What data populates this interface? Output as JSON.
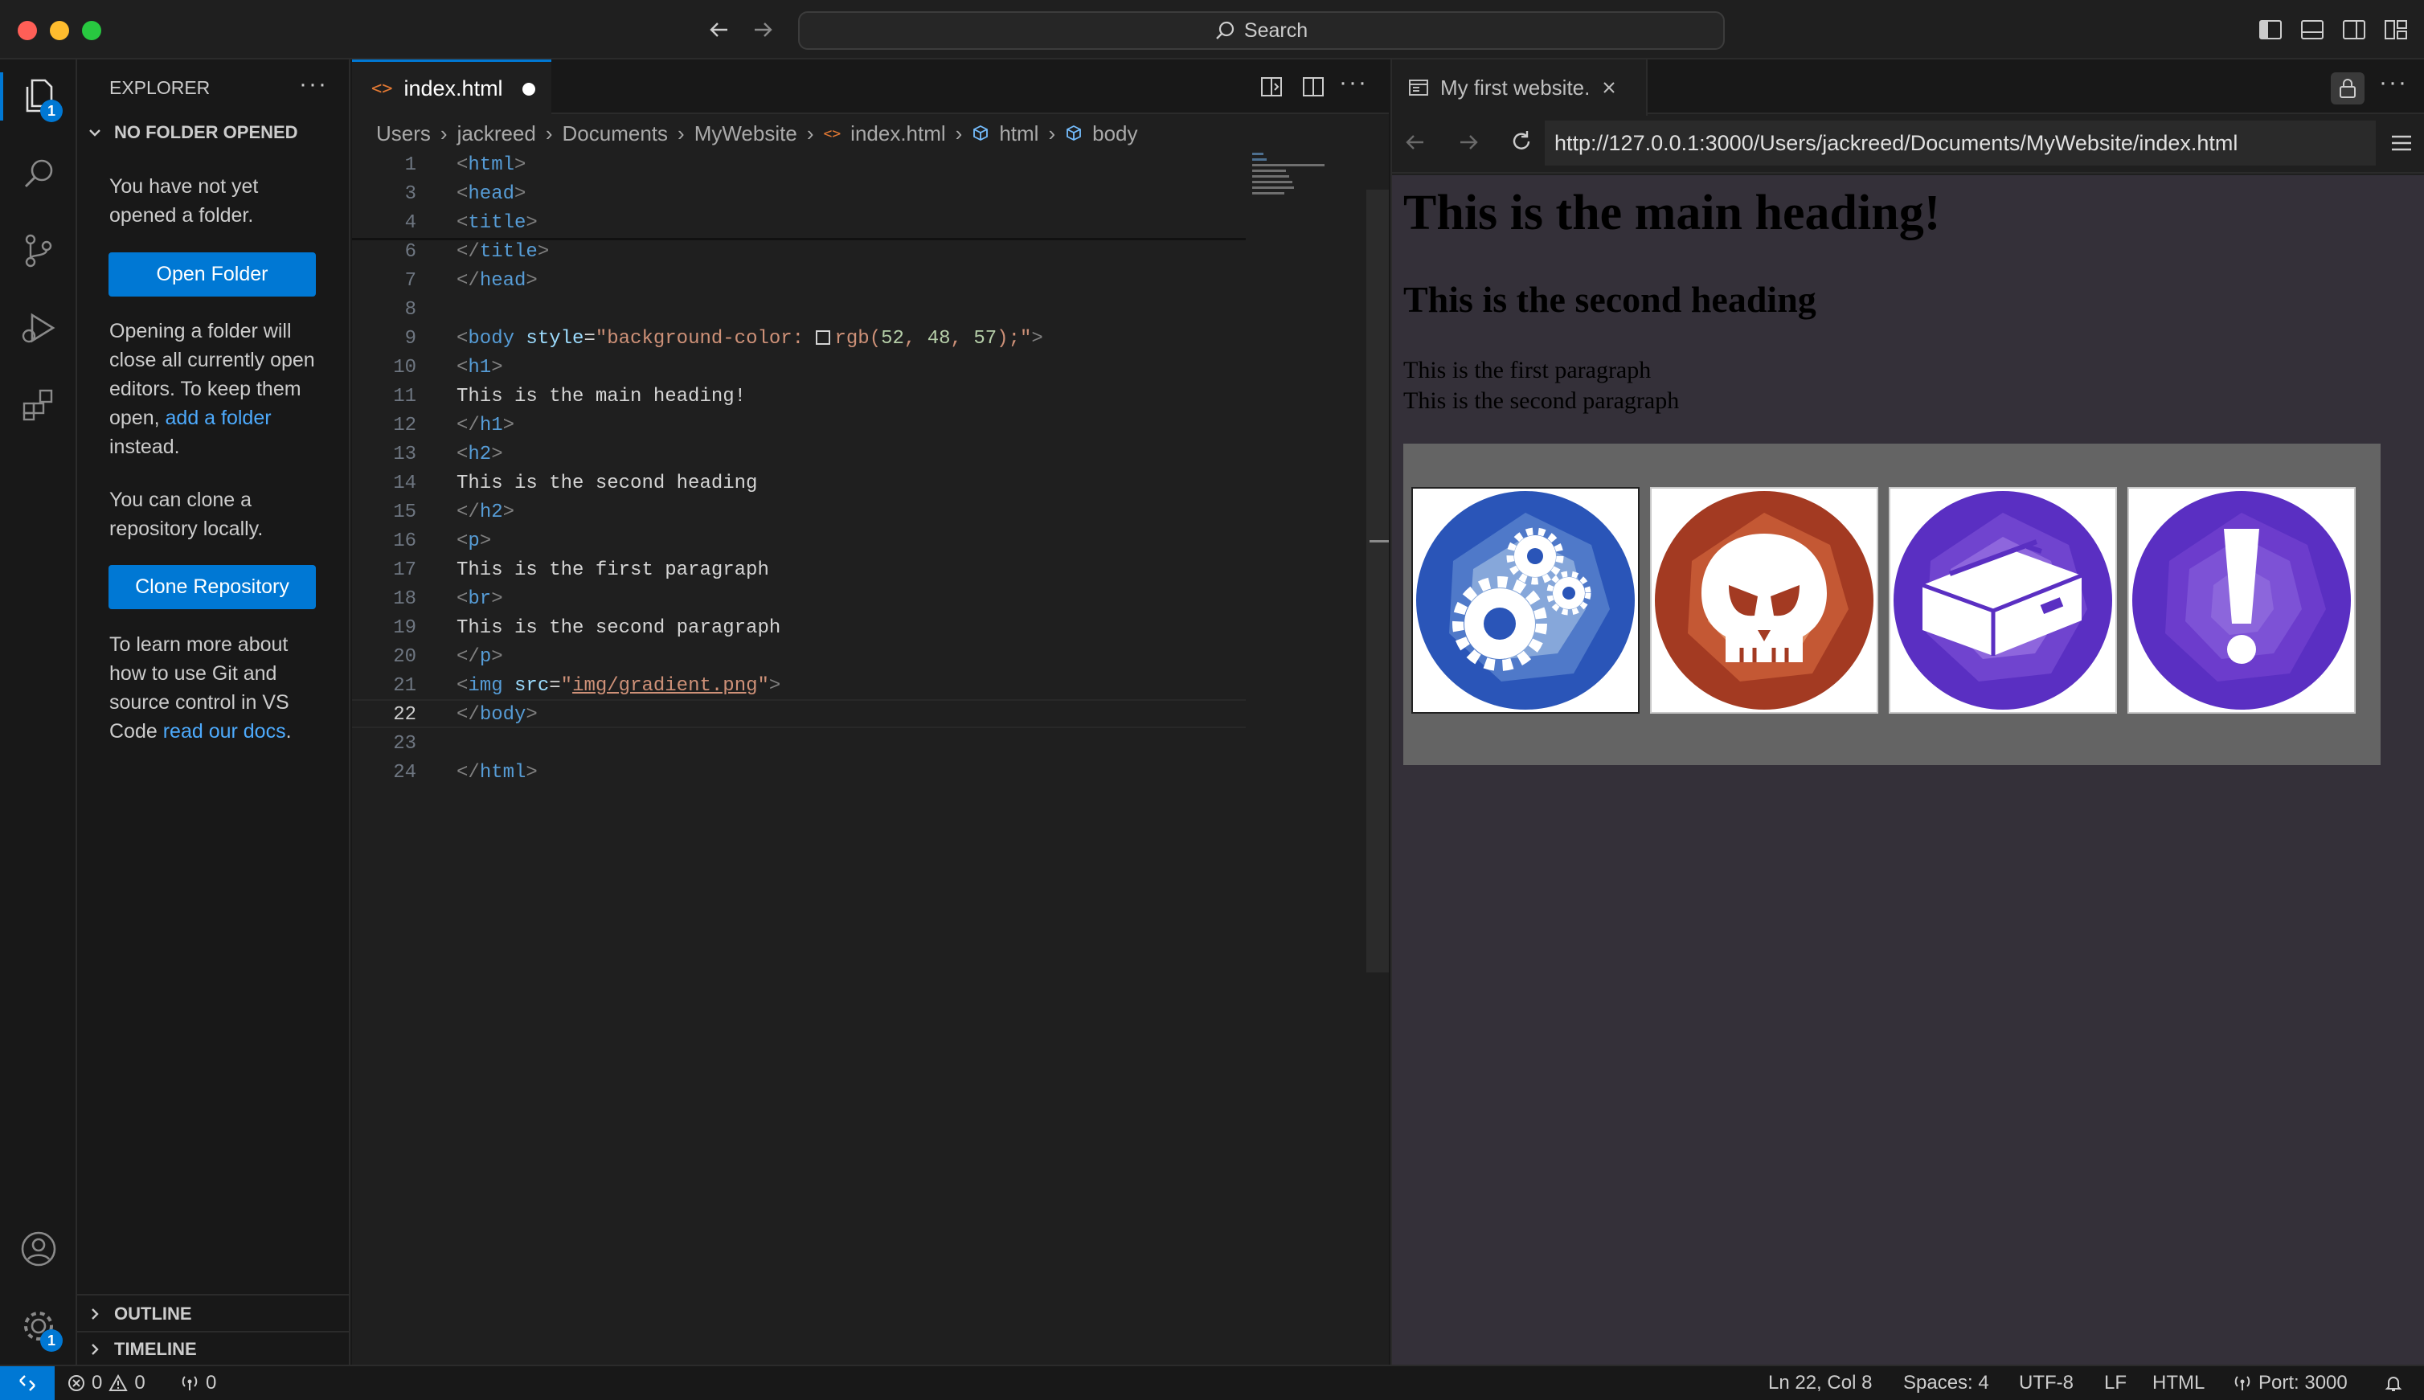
{
  "titlebar": {
    "search_label": "Search",
    "traffic_colors": [
      "#ff5f57",
      "#febc2e",
      "#28c840"
    ]
  },
  "activity_bar": {
    "explorer_badge": "1",
    "settings_badge": "1"
  },
  "sidebar": {
    "title": "EXPLORER",
    "section": "NO FOLDER OPENED",
    "msg1": "You have not yet opened a folder.",
    "open_folder_label": "Open Folder",
    "msg2_prefix": "Opening a folder will close all currently open editors. To keep them open,",
    "msg2_link": "add a folder",
    "msg2_suffix": "instead.",
    "msg3": "You can clone a repository locally.",
    "clone_label": "Clone Repository",
    "msg4_prefix": "To learn more about how to use Git and source control in VS Code",
    "msg4_link": "read our docs",
    "msg4_suffix": ".",
    "outline_label": "OUTLINE",
    "timeline_label": "TIMELINE"
  },
  "editor": {
    "tab_label": "index.html",
    "breadcrumb": [
      "Users",
      "jackreed",
      "Documents",
      "MyWebsite",
      "index.html",
      "html",
      "body"
    ],
    "lines": [
      {
        "n": "1",
        "code": "<html>"
      },
      {
        "n": "3",
        "code": "<head>"
      },
      {
        "n": "4",
        "code": "<title>"
      },
      {
        "n": "6",
        "code": "</title>"
      },
      {
        "n": "7",
        "code": "</head>"
      },
      {
        "n": "8",
        "code": ""
      },
      {
        "n": "9",
        "code": "<body style=\"background-color: rgb(52, 48, 57);\">"
      },
      {
        "n": "10",
        "code": "<h1>"
      },
      {
        "n": "11",
        "code": "This is the main heading!"
      },
      {
        "n": "12",
        "code": "</h1>"
      },
      {
        "n": "13",
        "code": "<h2>"
      },
      {
        "n": "14",
        "code": "This is the second heading"
      },
      {
        "n": "15",
        "code": "</h2>"
      },
      {
        "n": "16",
        "code": "<p>"
      },
      {
        "n": "17",
        "code": "This is the first paragraph"
      },
      {
        "n": "18",
        "code": "<br>"
      },
      {
        "n": "19",
        "code": "This is the second paragraph"
      },
      {
        "n": "20",
        "code": "</p>"
      },
      {
        "n": "21",
        "code": "<img src=\"img/gradient.png\">"
      },
      {
        "n": "22",
        "code": "</body>"
      },
      {
        "n": "23",
        "code": ""
      },
      {
        "n": "24",
        "code": "</html>"
      }
    ],
    "body_bg_color": "#343039",
    "current_line": "22"
  },
  "preview": {
    "tab_label": "My first website.",
    "url": "http://127.0.0.1:3000/Users/jackreed/Documents/MyWebsite/index.html",
    "h1": "This is the main heading!",
    "h2": "This is the second heading",
    "p1": "This is the first paragraph",
    "p2": "This is the second paragraph",
    "icons": [
      "gears-icon",
      "skull-icon",
      "box-icon",
      "exclamation-icon"
    ]
  },
  "statusbar": {
    "errors": "0",
    "warnings": "0",
    "ports_count": "0",
    "cursor": "Ln 22, Col 8",
    "spaces": "Spaces: 4",
    "encoding": "UTF-8",
    "eol": "LF",
    "language": "HTML",
    "port": "Port: 3000"
  }
}
